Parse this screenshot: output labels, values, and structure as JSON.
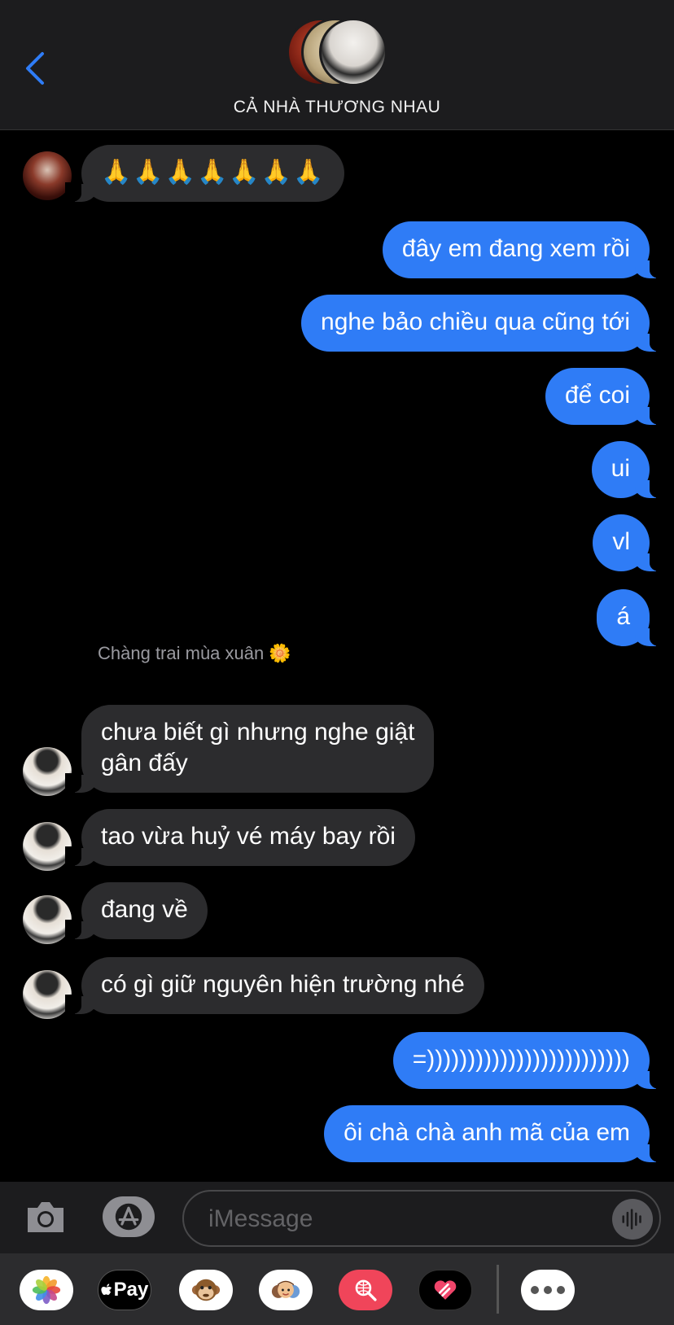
{
  "header": {
    "title": "CẢ NHÀ THƯƠNG NHAU"
  },
  "messages": [
    {
      "dir": "in",
      "text": "🙏🙏🙏🙏🙏🙏🙏"
    },
    {
      "dir": "out",
      "text": "đây em đang xem rồi"
    },
    {
      "dir": "out",
      "text": "nghe bảo chiều qua cũng tới"
    },
    {
      "dir": "out",
      "text": "để coi"
    },
    {
      "dir": "out",
      "text": "ui"
    },
    {
      "dir": "out",
      "text": "vl"
    },
    {
      "dir": "out",
      "text": "á"
    },
    {
      "dir": "in",
      "text_line1": "chưa biết gì nhưng nghe giật",
      "text_line2": "gân đấy"
    },
    {
      "dir": "in",
      "text": "tao vừa huỷ vé máy bay rồi"
    },
    {
      "dir": "in",
      "text": "đang về"
    },
    {
      "dir": "in",
      "text": "có gì giữ nguyên hiện trường nhé"
    },
    {
      "dir": "out",
      "text": "=)))))))))))))))))))))))))"
    },
    {
      "dir": "out",
      "text": "ôi chà chà anh mã của em"
    }
  ],
  "sender_name": "Chàng trai mùa xuân",
  "sender_emoji": "🌼",
  "input": {
    "placeholder": "iMessage"
  },
  "tray": {
    "apple_pay_label": "Pay"
  },
  "colors": {
    "outgoing_bubble": "#2f7cf6",
    "incoming_bubble": "#2c2c2e",
    "back_chevron": "#2f7cf6"
  },
  "icons": [
    "back-chevron-icon",
    "camera-icon",
    "app-store-icon",
    "voice-waveform-icon",
    "photos-app-icon",
    "apple-pay-icon",
    "monkey-memoji-icon",
    "memoji-stickers-icon",
    "web-search-icon",
    "digital-touch-icon",
    "more-apps-icon",
    "sunflower-icon"
  ]
}
